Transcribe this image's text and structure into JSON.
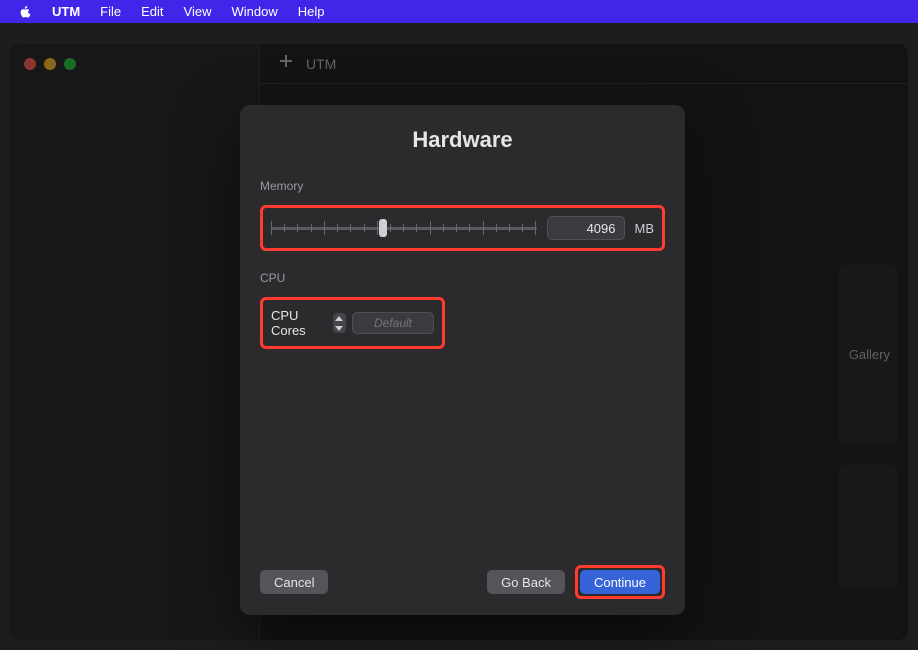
{
  "menubar": {
    "app": "UTM",
    "items": [
      "File",
      "Edit",
      "View",
      "Window",
      "Help"
    ]
  },
  "toolbar": {
    "title": "UTM"
  },
  "side_card": {
    "label": "Gallery"
  },
  "sheet": {
    "title": "Hardware",
    "memory": {
      "label": "Memory",
      "value": "4096",
      "unit": "MB",
      "slider_percent": 42
    },
    "cpu": {
      "label": "CPU",
      "cores_label": "CPU Cores",
      "placeholder": "Default"
    },
    "buttons": {
      "cancel": "Cancel",
      "back": "Go Back",
      "continue": "Continue"
    }
  }
}
